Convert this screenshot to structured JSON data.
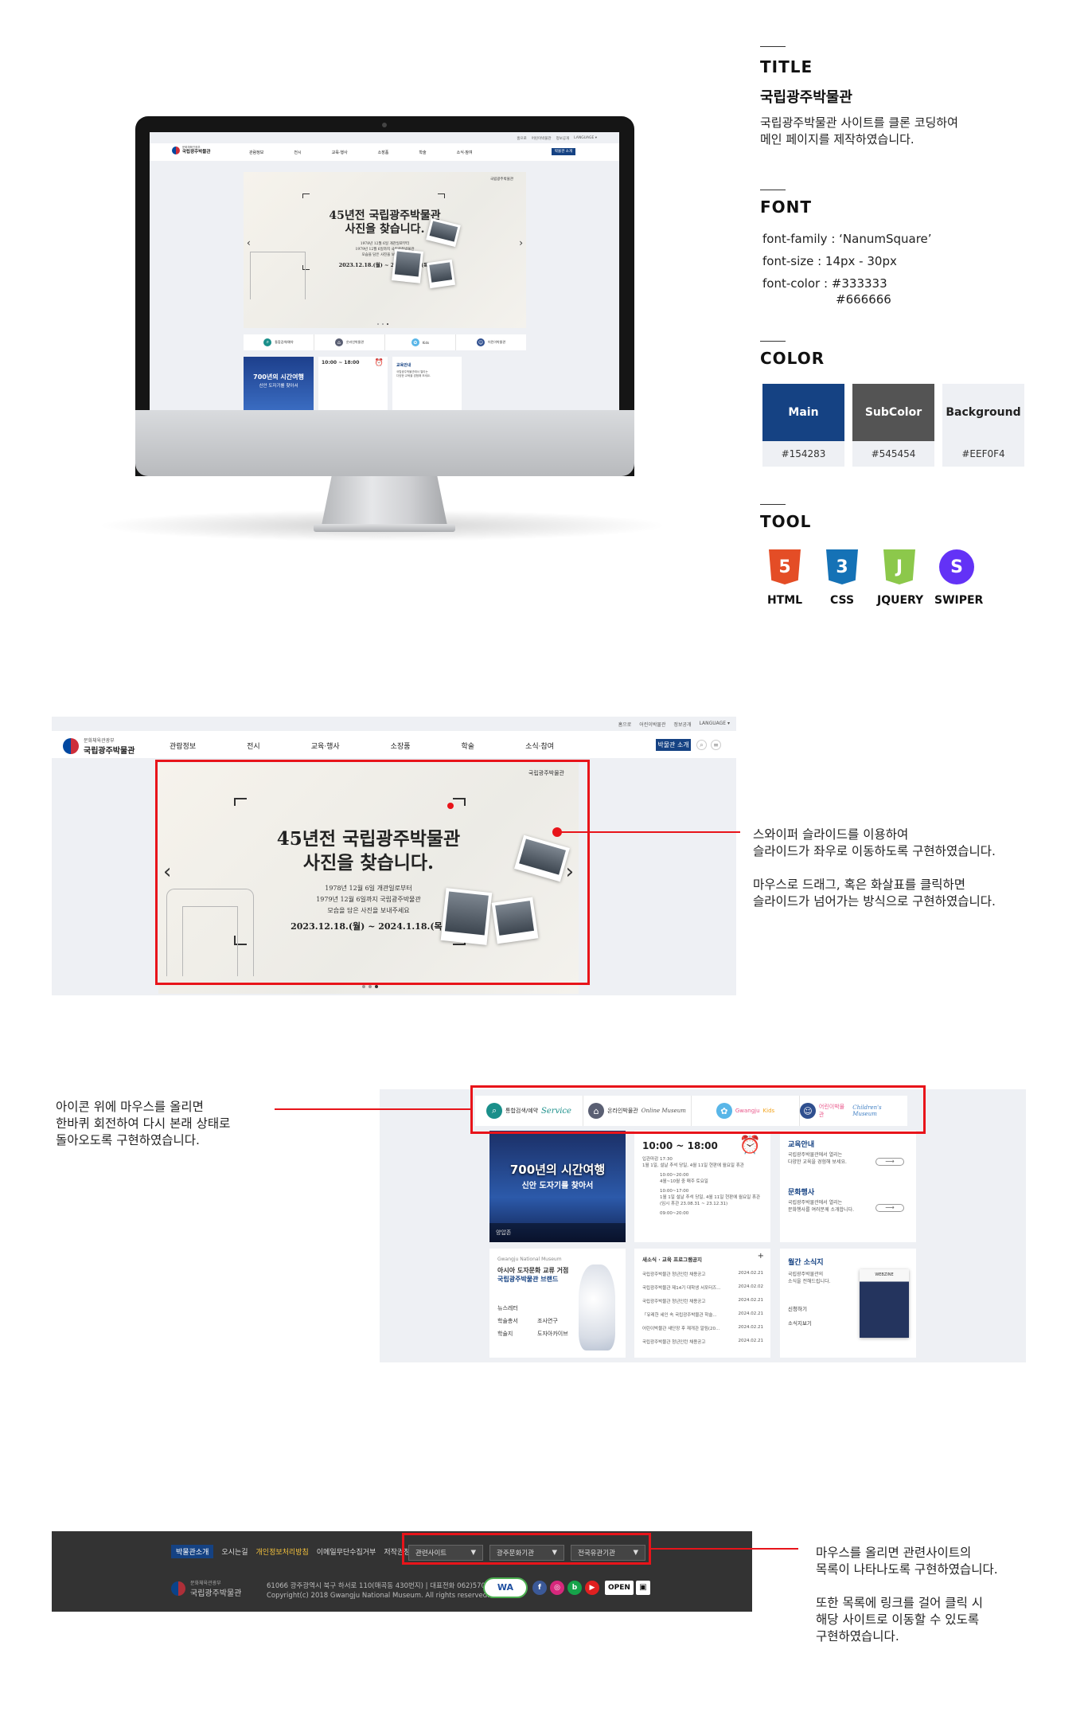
{
  "spec": {
    "title_heading": "TITLE",
    "title": "국립광주박물관",
    "description": [
      "국립광주박물관 사이트를 클론 코딩하여",
      "메인 페이지를 제작하였습니다."
    ],
    "font_heading": "FONT",
    "font_family": "font-family : ‘NanumSquare’",
    "font_size": "font-size : 14px - 30px",
    "font_color_1": "font-color : #333333",
    "font_color_2": "#666666",
    "color_heading": "COLOR",
    "colors": [
      {
        "name": "Main",
        "hex": "#154283",
        "swatch": "#154283",
        "text_color": "#ffffff"
      },
      {
        "name": "SubColor",
        "hex": "#545454",
        "swatch": "#545454",
        "text_color": "#ffffff"
      },
      {
        "name": "Background",
        "hex": "#EEF0F4",
        "swatch": "#eef0f4",
        "text_color": "#222222"
      }
    ],
    "tool_heading": "TOOL",
    "tools": [
      {
        "label": "HTML",
        "glyph": "5",
        "color": "#e44d26",
        "icon": "html5-icon"
      },
      {
        "label": "CSS",
        "glyph": "3",
        "color": "#1572b6",
        "icon": "css3-icon"
      },
      {
        "label": "JQUERY",
        "glyph": "J",
        "color": "#8cc84b",
        "icon": "js-icon"
      },
      {
        "label": "SWIPER",
        "glyph": "S",
        "color": "#6332f6",
        "icon": "swiper-icon"
      }
    ]
  },
  "site": {
    "utility_links": [
      "홈으로",
      "어린이박물관",
      "정보공개",
      "LANGUAGE ▾"
    ],
    "logo_ministry": "문화체육관광부",
    "logo_name": "국립광주박물관",
    "menu": [
      "관람정보",
      "전시",
      "교육·행사",
      "소장품",
      "학술",
      "소식·참여"
    ],
    "intro_button": "박물관 소개",
    "slide_brand": "국립광주박물관",
    "slide_title_1": "45년전 국립광주박물관",
    "slide_title_2": "사진을 찾습니다.",
    "slide_desc": [
      "1978년 12월 6일 개관일로부터",
      "1979년 12월 6일까지 국립광주박물관",
      "모습을 담은 사진을 보내주세요"
    ],
    "slide_dates": "2023.12.18.(월) ~ 2024.1.18.(목)",
    "quick_links": [
      {
        "label": "통합검색/예약",
        "script": "Service",
        "icon": "search-icon",
        "color": "#1a8f8a"
      },
      {
        "label": "온라인박물관",
        "script": "Online Museum",
        "icon": "museum-icon",
        "color": "#5a5f73"
      },
      {
        "label": "Gwangju",
        "script": "Kids",
        "icon": "kids-icon",
        "color": "#59b6e8"
      },
      {
        "label": "어린이박물관",
        "script": "Children's Museum",
        "icon": "child-icon",
        "color": "#2f4f8f"
      }
    ],
    "hours": "10:00 ~ 18:00",
    "hours_lines": [
      "입관마감 17:30",
      "1월 1일, 설날 추석 당일, 4월 11일 현판에 월요일 휴관",
      "10:00~20:00",
      "4월~10월 중 매주 토요일",
      "10:00~17:00",
      "1월 1일 설날 추석 당일, 4월 11일 현판에 월요일 휴관",
      "(임시 휴관 23.08.31 ~ 23.12.31)",
      "09:00~20:00"
    ],
    "banner_title": "700년의 시간여행",
    "banner_sub": "신안 도자기를 찾아서",
    "banner_caption": "양압존",
    "edu_title": "교육안내",
    "edu_text": [
      "국립광주박물관에서 열리는",
      "다양한 교육을 경험해 보세요."
    ],
    "event_title": "문화행사",
    "event_text": [
      "국립광주박물관에서 열리는",
      "문화행사를 여러분께 소개합니다."
    ],
    "brand_en": "Gwangju National Museum",
    "brand_title": [
      "아시아 도자문화 교류 거점",
      "국립광주박물관 브랜드"
    ],
    "brand_links": [
      "뉴스레터",
      "학술총서",
      "조사연구",
      "학술지",
      "도자아카이브"
    ],
    "news_tabs": "새소식 · 교육 프로그램공지",
    "news": [
      {
        "title": "국립광주박물관 청년인턴 채용공고",
        "date": "2024.02.21"
      },
      {
        "title": "국립광주박물관 제14기 대학생 서포터즈...",
        "date": "2024.02.02"
      },
      {
        "title": "국립광주박물관 청년인턴 채용공고",
        "date": "2024.02.21"
      },
      {
        "title": "「유레한 세인 속 국립광주박물관 학술...",
        "date": "2024.02.21"
      },
      {
        "title": "어린이박물관 새단장 후 재개관 알림(20...",
        "date": "2024.02.21"
      },
      {
        "title": "국립광주박물관 청년인턴 채용공고",
        "date": "2024.02.21"
      }
    ],
    "webzine_title": "월간 소식지",
    "webzine_text": [
      "국립광주박물관의",
      "소식을 전해드립니다."
    ],
    "webzine_btn_1": "신청하기",
    "webzine_btn_2": "소식지보기",
    "webzine_cover": "WEBZINE"
  },
  "notes": {
    "slider": [
      "스와이퍼 슬라이드를 이용하여",
      "슬라이드가 좌우로 이동하도록 구현하였습니다.",
      "",
      "마우스로 드래그, 혹은 화살표를 클릭하면",
      "슬라이드가 넘어가는 방식으로 구현하였습니다."
    ],
    "icons": [
      "아이콘 위에 마우스를 올리면",
      "한바퀴 회전하여 다시 본래 상태로",
      "돌아오도록 구현하였습니다."
    ],
    "footer": [
      "마우스를 올리면 관련사이트의",
      "목록이 나타나도록 구현하였습니다.",
      "",
      "또한 목록에 링크를 걸어 클릭 시",
      "해당 사이트로 이동할 수 있도록",
      "구현하였습니다."
    ]
  },
  "footer": {
    "links": [
      "박물관소개",
      "오시는길",
      "개인정보처리방침",
      "이메일무단수집거부",
      "저작권정책"
    ],
    "selects": [
      "관련사이트",
      "광주문화기관",
      "전국유관기관"
    ],
    "logo_ministry": "문화체육관광부",
    "logo_name": "국립광주박물관",
    "address": "61066 광주광역시 북구 하서로 110(매곡동 430번지) | 대표전화 062)570-7000",
    "copyright": "Copyright(c) 2018 Gwangju National Museum. All rights reserved.",
    "wa_label": "WA",
    "open_label": "OPEN",
    "sns": [
      "f",
      "◎",
      "b",
      "▶"
    ]
  }
}
